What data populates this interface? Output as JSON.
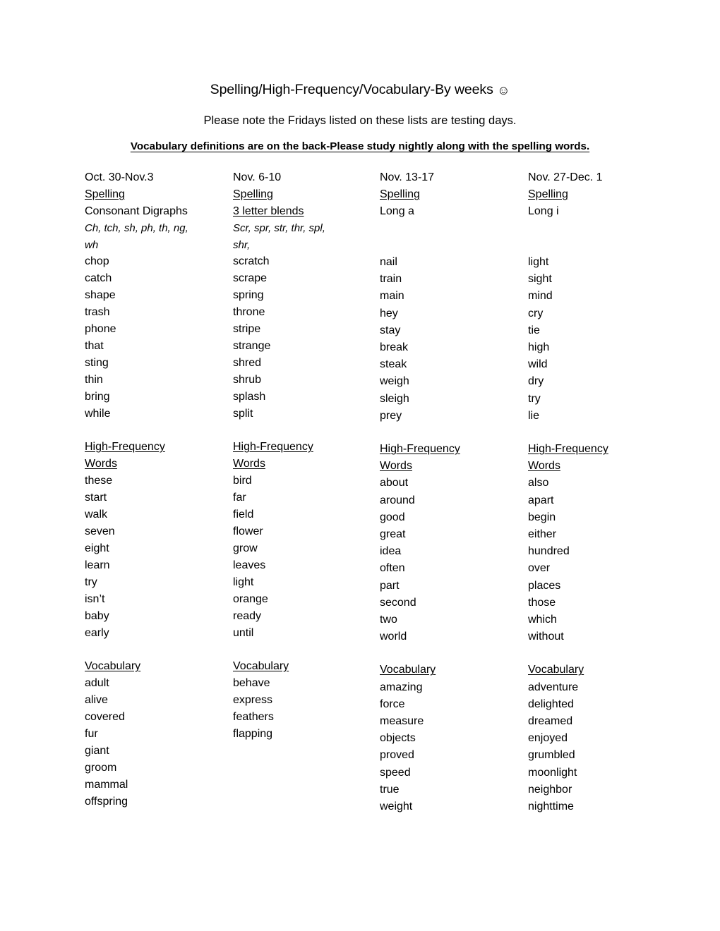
{
  "document": {
    "title": "Spelling/High-Frequency/Vocabulary-By weeks",
    "title_emoji": "☺",
    "subtitle": "Please note the Fridays listed on these lists are testing days.",
    "note": "Vocabulary definitions are on the back-Please study nightly along with the spelling words. "
  },
  "section_labels": {
    "spelling": "Spelling",
    "high_frequency_line1": "High-Frequency ",
    "high_frequency_line2": "Words",
    "vocabulary": "Vocabulary"
  },
  "columns": [
    {
      "date_range": "Oct. 30-Nov.3",
      "spelling_heading": "Spelling",
      "pattern": "Consonant Digraphs",
      "pattern_underlined": false,
      "examples_line1": "Ch, tch, sh, ph, th, ng,",
      "examples_line2": "wh",
      "spelling_words": [
        "chop",
        "catch",
        "shape",
        "trash",
        "phone",
        "that",
        "sting",
        "thin",
        "bring",
        "while"
      ],
      "high_frequency_words": [
        "these",
        "start",
        "walk",
        "seven",
        "eight",
        "learn",
        "try",
        "isn’t",
        "baby",
        "early"
      ],
      "vocabulary_words": [
        "adult",
        "alive",
        "covered",
        "fur",
        "giant",
        "groom",
        "mammal",
        "offspring"
      ]
    },
    {
      "date_range": "Nov. 6-10",
      "spelling_heading": "Spelling",
      "pattern": "3 letter blends",
      "pattern_underlined": true,
      "examples_line1": "Scr, spr, str, thr, spl,",
      "examples_line2": "shr,",
      "spelling_words": [
        "scratch",
        "scrape",
        "spring",
        "throne",
        "stripe",
        "strange",
        "shred",
        "shrub",
        "splash",
        "split"
      ],
      "high_frequency_words": [
        "bird",
        "far",
        "field",
        "flower",
        "grow",
        "leaves",
        "light",
        "orange",
        "ready",
        "until"
      ],
      "vocabulary_words": [
        "behave",
        "express",
        "feathers",
        "flapping"
      ]
    },
    {
      "date_range": "Nov. 13-17",
      "spelling_heading": "Spelling",
      "pattern": "Long a",
      "pattern_underlined": false,
      "examples_line1": "",
      "examples_line2": "",
      "spelling_words": [
        "nail",
        "train",
        "main",
        "hey",
        "stay",
        "break",
        "steak",
        "weigh",
        "sleigh",
        "prey"
      ],
      "high_frequency_words": [
        "about",
        "around",
        "good",
        "great",
        "idea",
        "often",
        "part",
        "second",
        "two",
        "world"
      ],
      "vocabulary_words": [
        "amazing",
        "force",
        "measure",
        "objects",
        "proved",
        "speed",
        "true",
        "weight"
      ]
    },
    {
      "date_range": "Nov. 27-Dec. 1",
      "spelling_heading": "Spelling",
      "pattern": "Long i",
      "pattern_underlined": false,
      "examples_line1": "",
      "examples_line2": "",
      "spelling_words": [
        "light",
        "sight",
        "mind",
        "cry",
        "tie",
        "high",
        "wild",
        "dry",
        "try",
        "lie"
      ],
      "high_frequency_words": [
        "also",
        "apart",
        "begin",
        "either",
        "hundred",
        "over",
        "places",
        "those",
        "which",
        "without"
      ],
      "vocabulary_words": [
        "adventure",
        "delighted",
        "dreamed",
        "enjoyed",
        "grumbled",
        "moonlight",
        "neighbor",
        "nighttime"
      ]
    }
  ]
}
